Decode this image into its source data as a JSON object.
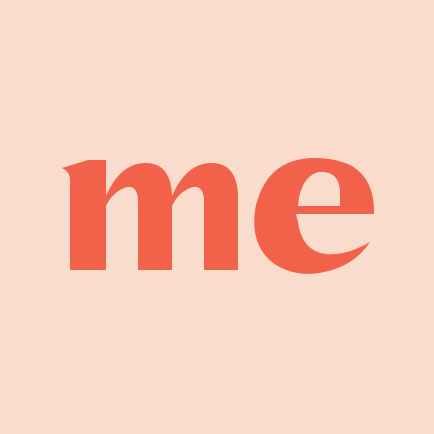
{
  "logo": {
    "wordmark": "me",
    "background_color": "#F9DCCB",
    "mark_color": "#F2624A"
  }
}
